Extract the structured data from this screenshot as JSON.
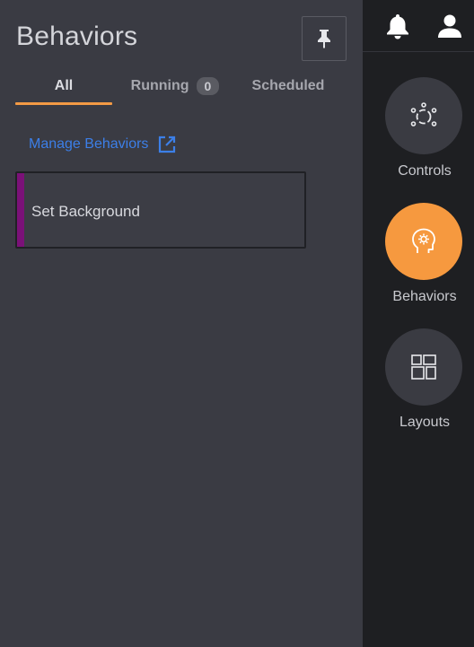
{
  "panel": {
    "title": "Behaviors",
    "pin_icon": "pin-icon"
  },
  "tabs": [
    {
      "label": "All",
      "active": true
    },
    {
      "label": "Running",
      "badge": "0",
      "active": false
    },
    {
      "label": "Scheduled",
      "active": false
    }
  ],
  "manage": {
    "label": "Manage Behaviors",
    "icon": "external-link-icon"
  },
  "behaviors": [
    {
      "label": "Set Background",
      "accent_color": "#7b1178"
    }
  ],
  "topbar": {
    "notifications_icon": "bell-icon",
    "account_icon": "user-icon"
  },
  "rail": [
    {
      "label": "Controls",
      "icon": "controls-icon",
      "active": false
    },
    {
      "label": "Behaviors",
      "icon": "behaviors-icon",
      "active": true
    },
    {
      "label": "Layouts",
      "icon": "layouts-icon",
      "active": false
    }
  ],
  "colors": {
    "accent": "#f6993f",
    "link": "#3c7fe8",
    "panel_bg": "#3a3b43",
    "rail_bg": "#1e1f22"
  }
}
